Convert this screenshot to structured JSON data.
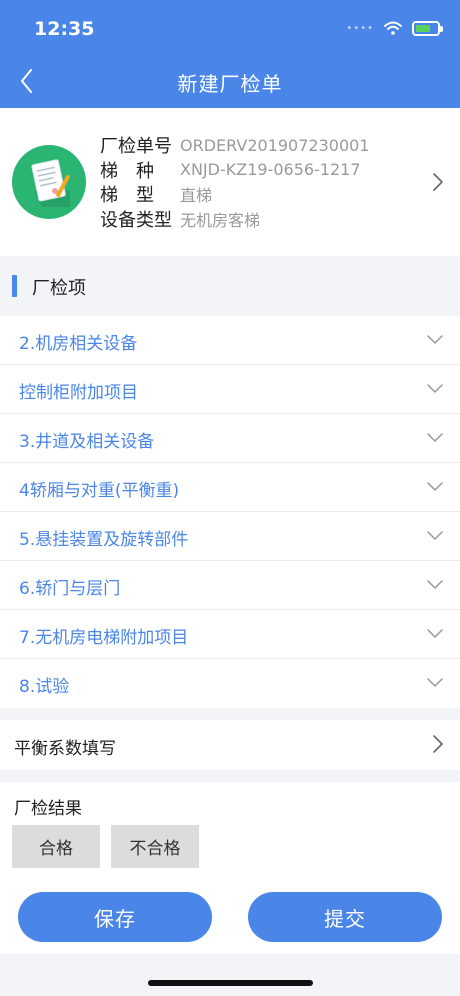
{
  "status": {
    "time": "12:35",
    "signal_dots": "••••"
  },
  "nav": {
    "title": "新建厂检单"
  },
  "order": {
    "rows": [
      {
        "label": "厂检单号",
        "value": "ORDERV201907230001"
      },
      {
        "label": "梯　种",
        "value": "XNJD-KZ19-0656-1217"
      },
      {
        "label": "梯　型",
        "value": "直梯"
      },
      {
        "label": "设备类型",
        "value": "无机房客梯"
      }
    ]
  },
  "section": {
    "title": "厂检项"
  },
  "items": [
    {
      "label": "2.机房相关设备"
    },
    {
      "label": "控制柜附加项目"
    },
    {
      "label": "3.井道及相关设备"
    },
    {
      "label": "4轿厢与对重(平衡重)"
    },
    {
      "label": "5.悬挂装置及旋转部件"
    },
    {
      "label": "6.轿门与层门"
    },
    {
      "label": "7.无机房电梯附加项目"
    },
    {
      "label": "8.试验"
    }
  ],
  "balance": {
    "label": "平衡系数填写"
  },
  "result": {
    "title": "厂检结果",
    "pass": "合格",
    "fail": "不合格",
    "save": "保存",
    "submit": "提交"
  },
  "colors": {
    "accent": "#4a86e8",
    "icon_bg": "#2bb573",
    "battery": "#5ad15a"
  }
}
